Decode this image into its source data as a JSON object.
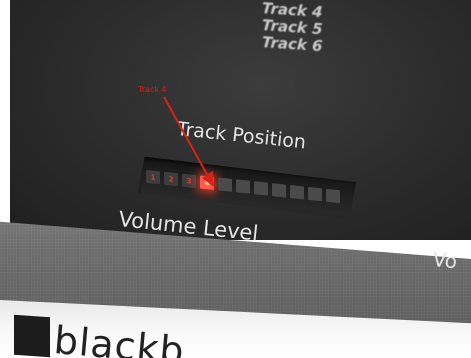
{
  "panel": {
    "track_list": [
      "Track 4",
      "Track 5",
      "Track 6"
    ],
    "track_position_label": "Track Position",
    "volume_level_label": "Volume Level",
    "vo_label_fragment": "Vo"
  },
  "led_display": {
    "numbers": [
      "1",
      "2",
      "3",
      "4"
    ],
    "active_track": 4,
    "unlabeled_segments": 7,
    "accent_color": "#ff5a45"
  },
  "annotation": {
    "label": "Track 4",
    "color": "#d42418"
  },
  "brand": {
    "logo_text": "blackb"
  }
}
